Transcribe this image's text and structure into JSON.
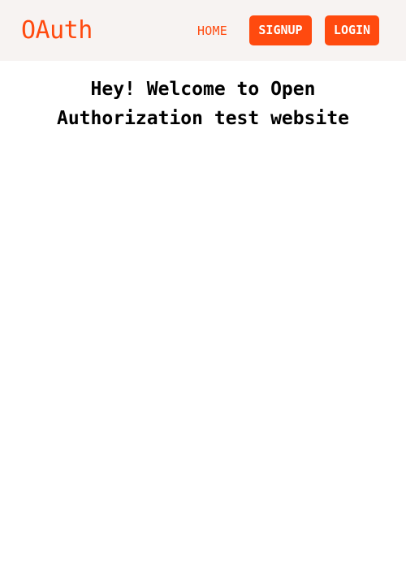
{
  "header": {
    "logo": "OAuth",
    "nav": {
      "home_label": "HOME",
      "signup_label": "SIGNUP",
      "login_label": "LOGIN"
    }
  },
  "main": {
    "welcome_text": "Hey! Welcome to Open Authorization test website"
  },
  "colors": {
    "accent": "#ff4a0f",
    "header_bg": "#f7f3f2",
    "page_bg": "#ffffff",
    "text": "#000000"
  }
}
